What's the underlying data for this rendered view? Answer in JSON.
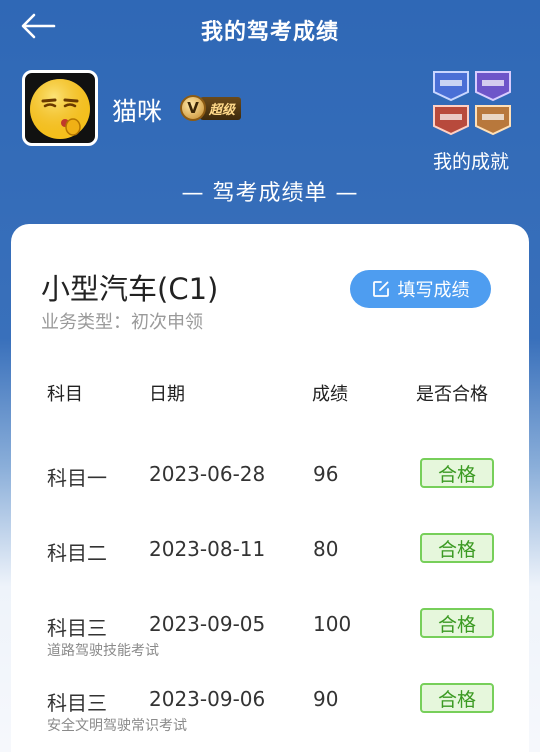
{
  "header": {
    "title": "我的驾考成绩",
    "back_icon": "arrow-left-icon"
  },
  "profile": {
    "username": "猫咪",
    "vip_letter": "V",
    "vip_label": "超级",
    "achievements_label": "我的成就",
    "avatar_icon": "emoji-face-icon"
  },
  "sheet_title": "— 驾考成绩单 —",
  "card": {
    "vehicle": "小型汽车(C1)",
    "business_type": "业务类型：初次申领",
    "fill_button": "填写成绩",
    "fill_icon": "edit-icon",
    "columns": [
      "科目",
      "日期",
      "成绩",
      "是否合格"
    ],
    "rows": [
      {
        "subject": "科目一",
        "date": "2023-06-28",
        "score": "96",
        "result": "合格",
        "note": ""
      },
      {
        "subject": "科目二",
        "date": "2023-08-11",
        "score": "80",
        "result": "合格",
        "note": ""
      },
      {
        "subject": "科目三",
        "date": "2023-09-05",
        "score": "100",
        "result": "合格",
        "note": "道路驾驶技能考试"
      },
      {
        "subject": "科目三",
        "date": "2023-09-06",
        "score": "90",
        "result": "合格",
        "note": "安全文明驾驶常识考试"
      }
    ]
  },
  "colors": {
    "primary": "#3a6fb8",
    "button": "#4e9df0",
    "pass_green": "#3b9a22"
  }
}
